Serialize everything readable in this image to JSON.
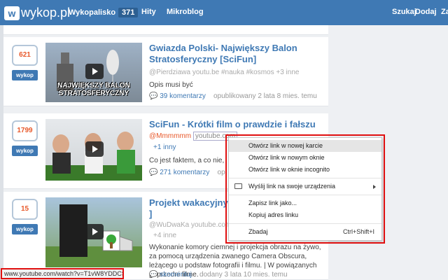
{
  "nav": {
    "logo_letter": "w",
    "logo_text": "wykop.pl",
    "wykopalisko": "Wykopalisko",
    "wykopalisko_count": "371",
    "hity": "Hity",
    "mikroblog": "Mikroblog",
    "szukaj": "Szukaj",
    "dodaj": "Dodaj",
    "zaloguj": "Zaloguj"
  },
  "posts": [
    {
      "votes": "621",
      "vote_label": "wykop",
      "thumb_text_1": "NAJWIĘKSZY BALON",
      "thumb_text_2": "STRATOSFERYCZNY",
      "title": "Gwiazda Polski- Największy Balon Stratosferyczny [SciFun]",
      "author": "@Pierdziawa",
      "domain": "youtu.be",
      "tags": "#nauka  #kosmos  +3 inne",
      "desc": "Opis musi być",
      "comments": "39 komentarzy",
      "published": "opublikowany 2 lata 8 mies. temu"
    },
    {
      "votes": "1799",
      "vote_label": "wykop",
      "title": "SciFun - Krótki film o prawdzie i fałszu",
      "author": "@Mmmmmm",
      "domain": "youtube.com",
      "extra": "+1 inny",
      "desc": "Co jest faktem, a co nie, w",
      "comments": "271 komentarzy",
      "published": "op"
    },
    {
      "votes": "15",
      "vote_label": "wykop",
      "title": "Projekt wakacyjny: C",
      "title_2": "]",
      "author": "@WuDwaKa",
      "domain": "youtube.com",
      "extra": "+4 inne",
      "desc": "Wykonanie komory ciemnej i projekcja obrazu na żywo, za pomocą urządzenia zwanego Camera Obscura, leżącego u podstaw fotografii i filmu. | W powiązanych poprzedni filme.",
      "comments": "skomentuj",
      "published": "dodany 3 lata 10 mies. temu"
    }
  ],
  "context_menu": {
    "items": [
      "Otwórz link w nowej karcie",
      "Otwórz link w nowym oknie",
      "Otwórz link w oknie incognito",
      "Wyślij link na swoje urządzenia",
      "Zapisz link jako...",
      "Kopiuj adres linku",
      "Zbadaj"
    ],
    "zbadaj_shortcut": "Ctrl+Shift+I"
  },
  "status_url": "www.youtube.com/watch?v=T1vW8YDDCSc",
  "colors": {
    "brand": "#3f79b4",
    "vote_count": "#e8592b",
    "highlight": "#e01010"
  }
}
